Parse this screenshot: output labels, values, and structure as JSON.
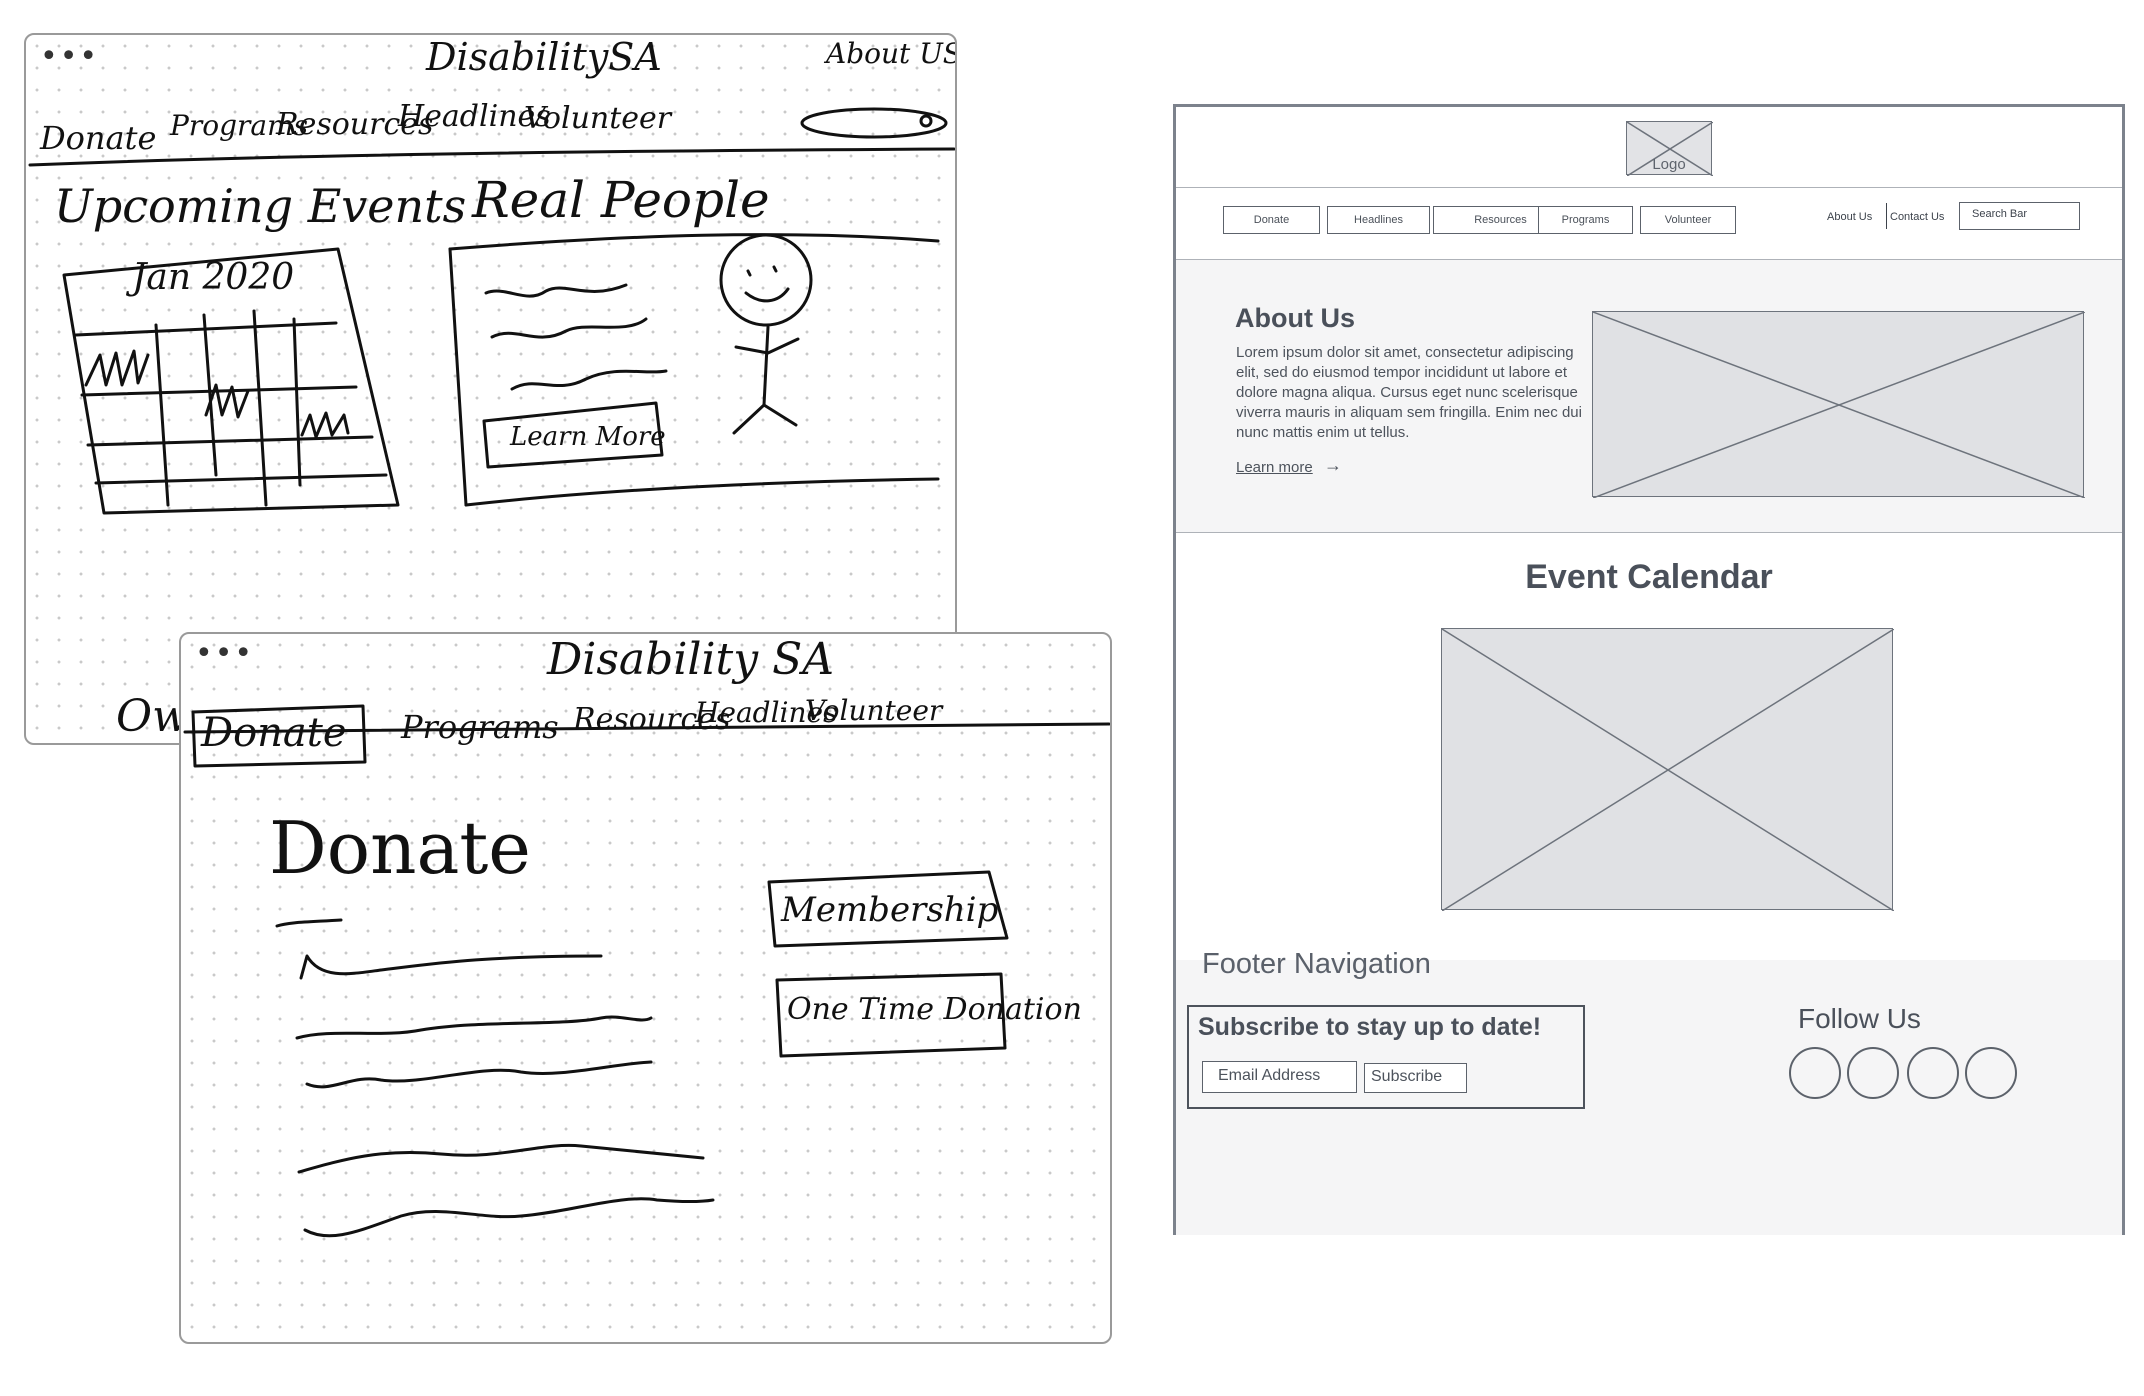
{
  "sketch_home": {
    "brand": "DisabilitySA",
    "about_link": "About US",
    "nav": [
      "Donate",
      "Programs",
      "Resources",
      "Headlines",
      "Volunteer"
    ],
    "events_title": "Upcoming Events",
    "calendar_month": "Jan 2020",
    "people_title": "Real People",
    "learn_more": "Learn More",
    "cutoff_text": "Ow"
  },
  "sketch_donate": {
    "brand": "Disability SA",
    "nav": [
      "Donate",
      "Programs",
      "Resources",
      "Headlines",
      "Volunteer"
    ],
    "page_title": "Donate",
    "membership": "Membership",
    "one_time": "One Time Donation"
  },
  "wireframe": {
    "logo": "Logo",
    "nav": [
      "Donate",
      "Headlines",
      "Resources",
      "Programs",
      "Volunteer"
    ],
    "about_link": "About Us",
    "contact_link": "Contact Us",
    "search_placeholder": "Search Bar",
    "about_title": "About Us",
    "about_text": "Lorem ipsum dolor sit amet, consectetur adipiscing elit, sed do eiusmod tempor incididunt ut labore et dolore magna aliqua. Cursus eget nunc scelerisque viverra mauris in aliquam sem fringilla. Enim nec dui nunc mattis enim ut tellus.",
    "learn_more": "Learn more",
    "calendar_title": "Event Calendar",
    "footer_title": "Footer Navigation",
    "subscribe_title": "Subscribe to stay up to date!",
    "email_placeholder": "Email Address",
    "subscribe_button": "Subscribe",
    "follow_title": "Follow Us",
    "social_icons": [
      "social-icon-1",
      "social-icon-2",
      "social-icon-3",
      "social-icon-4"
    ]
  },
  "colors": {
    "wire_stroke": "#7c828c",
    "wire_fill": "#e0e1e4",
    "ink": "#111111"
  }
}
